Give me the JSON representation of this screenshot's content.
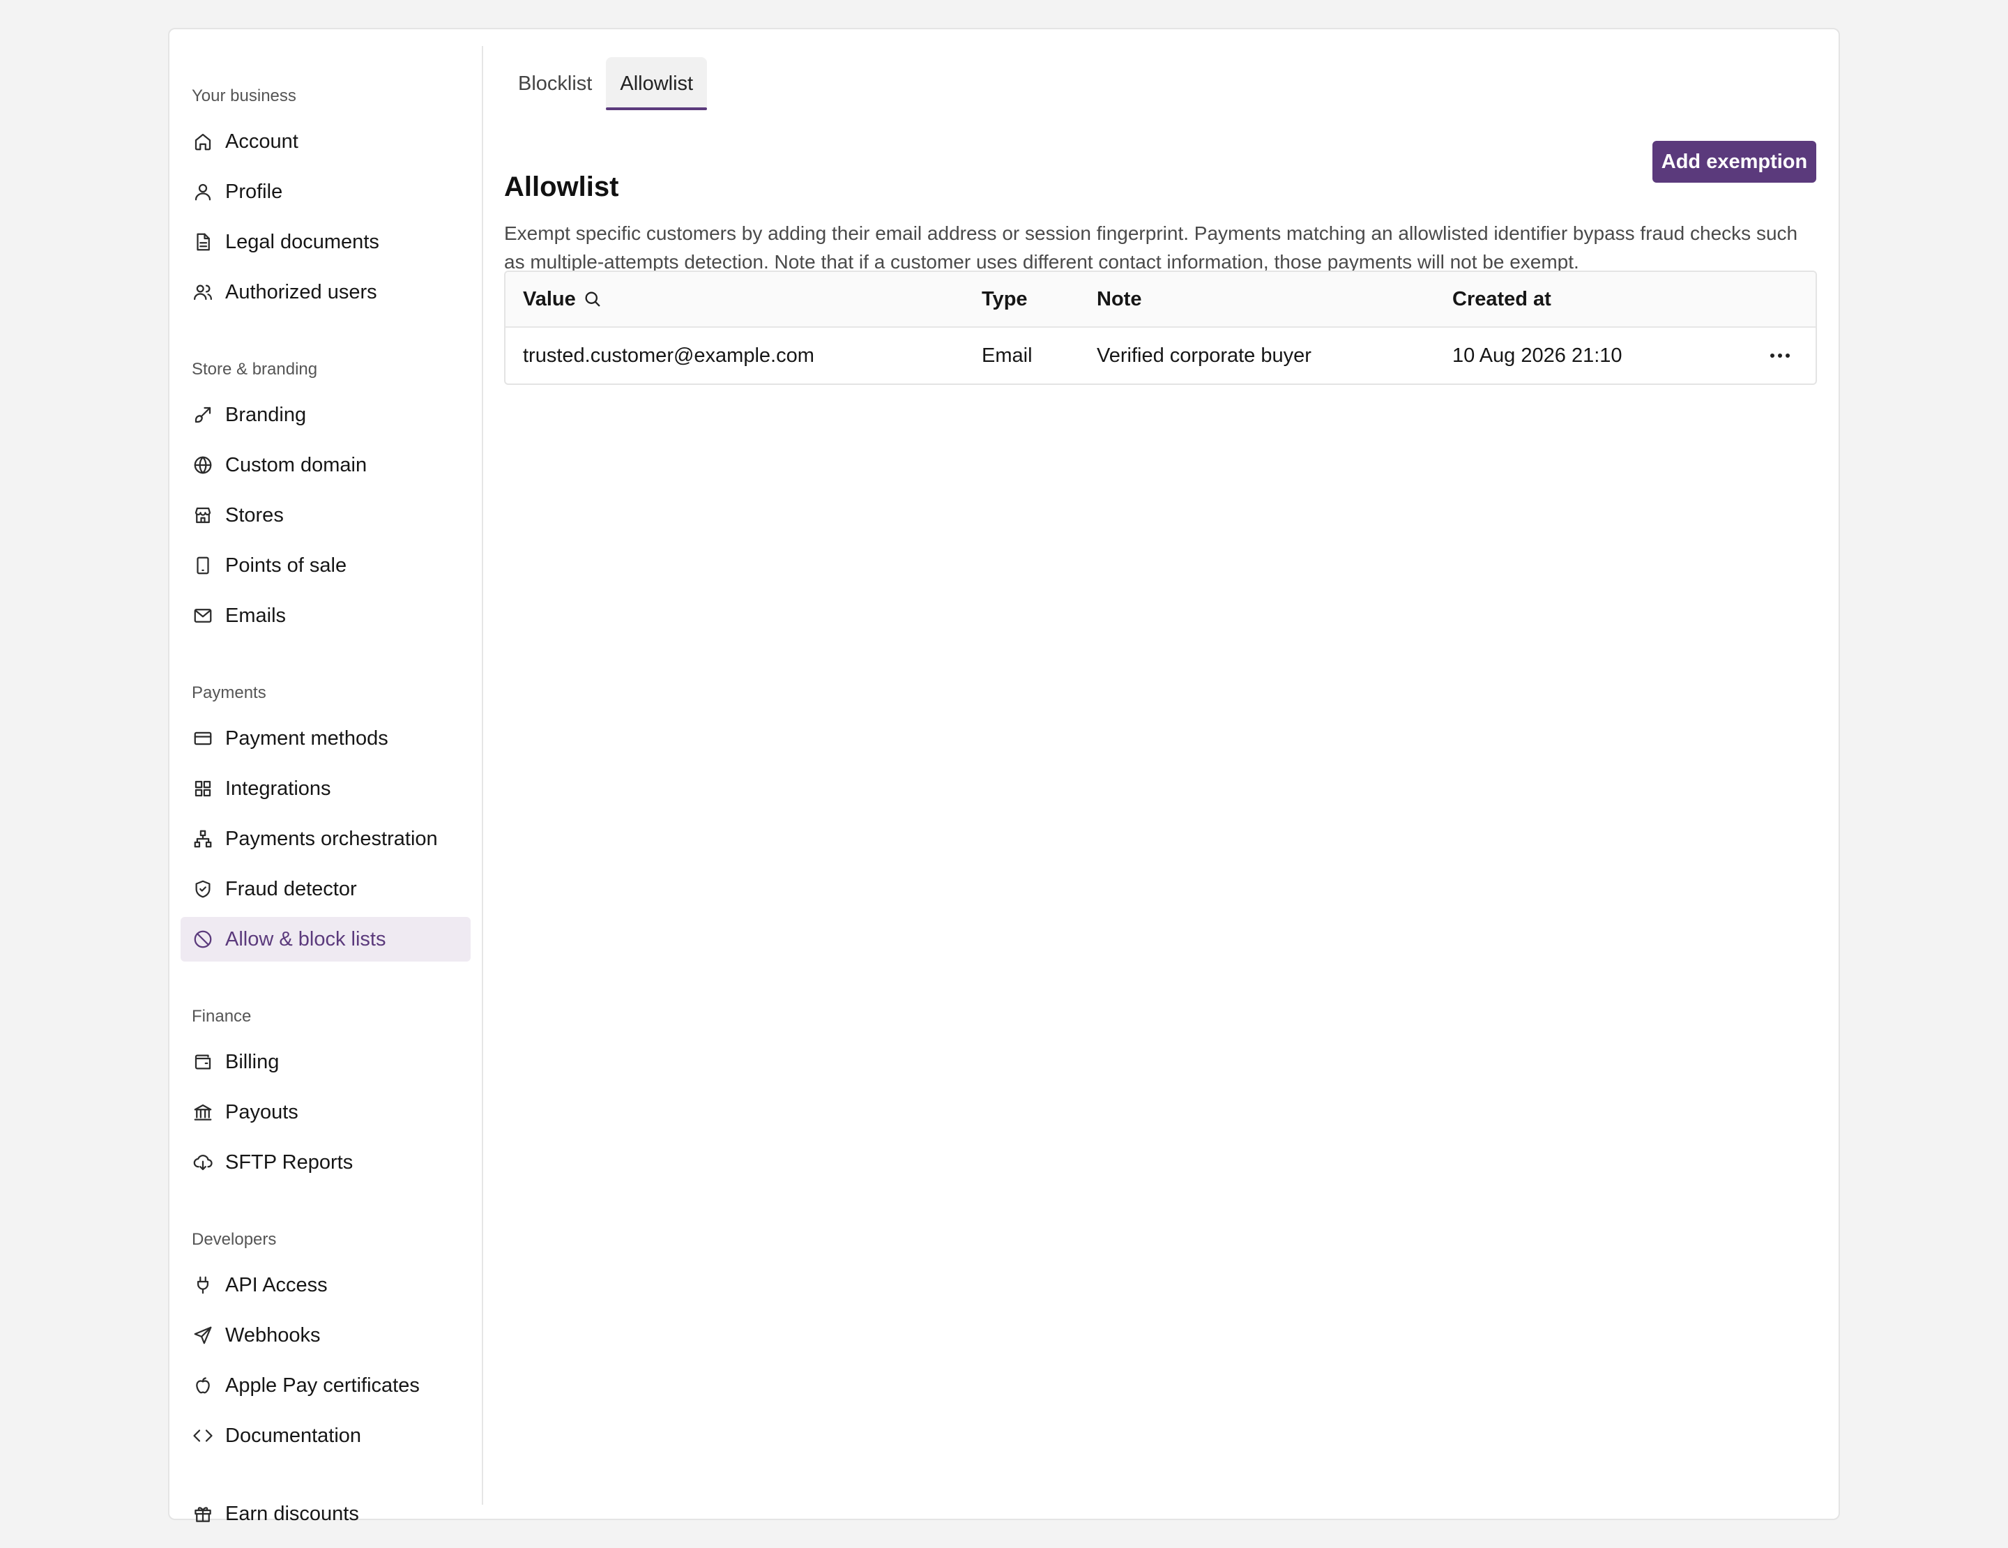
{
  "sidebar": {
    "sections": [
      {
        "label": "Your business",
        "items": [
          {
            "label": "Account",
            "icon": "home-icon"
          },
          {
            "label": "Profile",
            "icon": "user-icon"
          },
          {
            "label": "Legal documents",
            "icon": "document-icon"
          },
          {
            "label": "Authorized users",
            "icon": "users-icon"
          }
        ]
      },
      {
        "label": "Store & branding",
        "items": [
          {
            "label": "Branding",
            "icon": "brush-icon"
          },
          {
            "label": "Custom domain",
            "icon": "globe-icon"
          },
          {
            "label": "Stores",
            "icon": "store-icon"
          },
          {
            "label": "Points of sale",
            "icon": "tablet-icon"
          },
          {
            "label": "Emails",
            "icon": "mail-icon"
          }
        ]
      },
      {
        "label": "Payments",
        "items": [
          {
            "label": "Payment methods",
            "icon": "credit-card-icon"
          },
          {
            "label": "Integrations",
            "icon": "grid-icon"
          },
          {
            "label": "Payments orchestration",
            "icon": "network-icon"
          },
          {
            "label": "Fraud detector",
            "icon": "shield-check-icon"
          },
          {
            "label": "Allow & block lists",
            "icon": "ban-icon",
            "active": true
          }
        ]
      },
      {
        "label": "Finance",
        "items": [
          {
            "label": "Billing",
            "icon": "wallet-icon"
          },
          {
            "label": "Payouts",
            "icon": "bank-icon"
          },
          {
            "label": "SFTP Reports",
            "icon": "cloud-download-icon"
          }
        ]
      },
      {
        "label": "Developers",
        "items": [
          {
            "label": "API Access",
            "icon": "plug-icon"
          },
          {
            "label": "Webhooks",
            "icon": "send-icon"
          },
          {
            "label": "Apple Pay certificates",
            "icon": "apple-icon"
          },
          {
            "label": "Documentation",
            "icon": "code-icon"
          }
        ]
      }
    ],
    "footer_item": {
      "label": "Earn discounts",
      "icon": "gift-icon"
    }
  },
  "tabs": [
    {
      "label": "Blocklist",
      "active": false
    },
    {
      "label": "Allowlist",
      "active": true
    }
  ],
  "page": {
    "title": "Allowlist",
    "add_button": "Add exemption",
    "description": "Exempt specific customers by adding their email address or session fingerprint. Payments matching an allowlisted identifier bypass fraud checks such as multiple-attempts detection. Note that if a customer uses different contact information, those payments will not be exempt."
  },
  "table": {
    "columns": [
      "Value",
      "Type",
      "Note",
      "Created at"
    ],
    "rows": [
      {
        "value": "trusted.customer@example.com",
        "type": "Email",
        "note": "Verified corporate buyer",
        "created_at": "10 Aug 2026 21:10"
      }
    ]
  },
  "colors": {
    "accent": "#5b3a7c",
    "active_nav_bg": "#efeaf2",
    "page_bg": "#f3f3f3"
  }
}
